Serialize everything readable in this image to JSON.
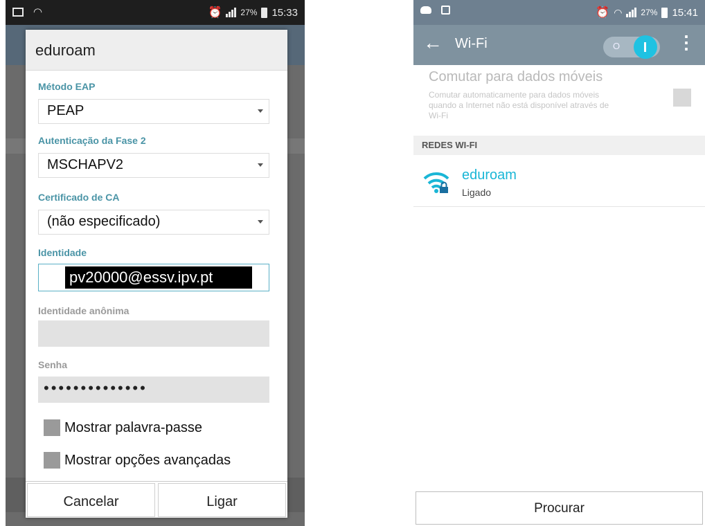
{
  "left_phone": {
    "status": {
      "battery": "27%",
      "time": "15:33"
    },
    "dialog": {
      "title": "eduroam",
      "eap_label": "Método EAP",
      "eap_value": "PEAP",
      "phase2_label": "Autenticação da Fase 2",
      "phase2_value": "MSCHAPV2",
      "ca_label": "Certificado de CA",
      "ca_value": "(não especificado)",
      "identity_label": "Identidade",
      "identity_value": "pv20000@essv.ipv.pt",
      "anon_label": "Identidade anônima",
      "password_label": "Senha",
      "password_value": "••••••••••••••",
      "show_password": "Mostrar palavra-passe",
      "show_advanced": "Mostrar opções avançadas",
      "cancel": "Cancelar",
      "connect": "Ligar"
    }
  },
  "right_phone": {
    "status": {
      "battery": "27%",
      "time": "15:41"
    },
    "appbar": {
      "title": "Wi-Fi",
      "toggle_state": "on"
    },
    "switch_mobile": {
      "title": "Comutar para dados móveis",
      "desc": "Comutar automaticamente para dados móveis quando a Internet não está disponível através de Wi-Fi"
    },
    "section_header": "REDES WI-FI",
    "network": {
      "name": "eduroam",
      "status": "Ligado"
    },
    "search_button": "Procurar"
  }
}
